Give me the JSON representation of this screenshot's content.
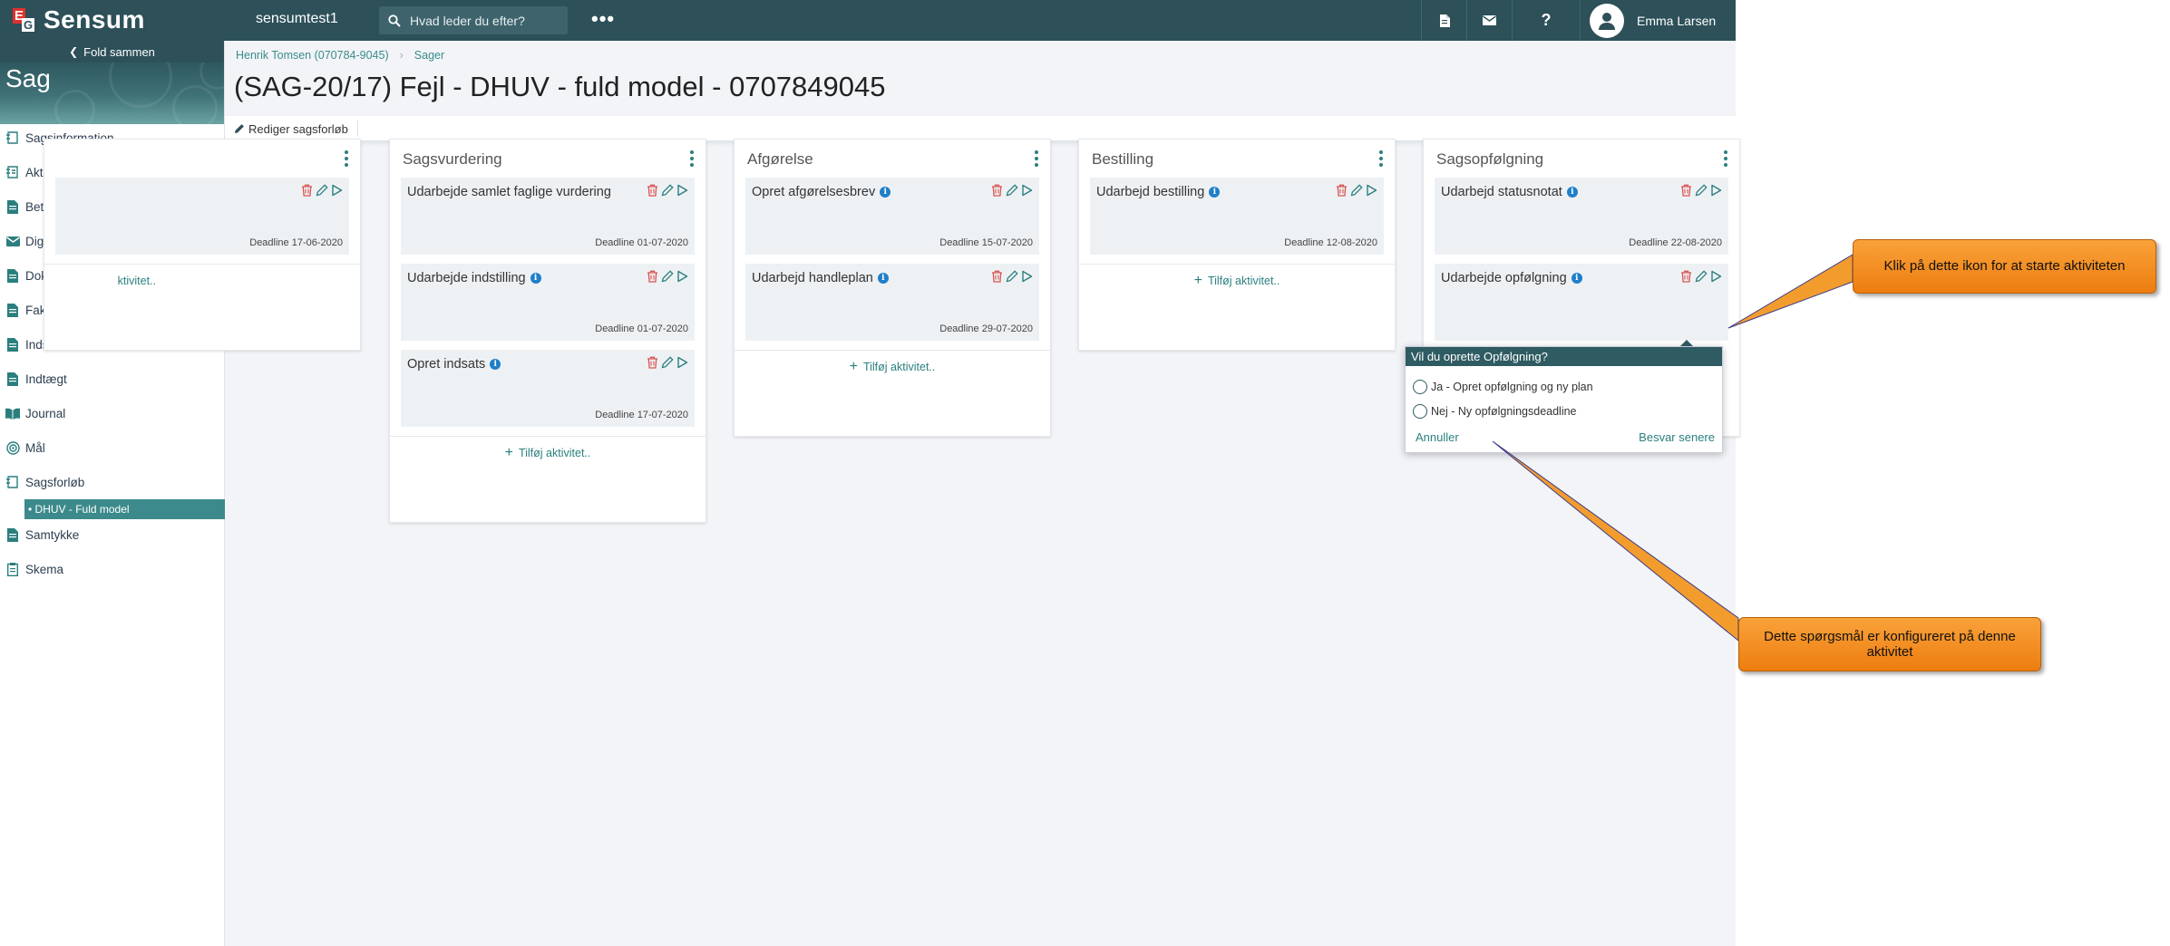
{
  "app": {
    "logo_text": "Sensum",
    "logo_mark": {
      "e": "E",
      "g": "G"
    },
    "tenant": "sensumtest1",
    "search_placeholder": "Hvad leder du efter?",
    "more": "•••",
    "user_name": "Emma Larsen"
  },
  "icons": {
    "topbar": [
      "document-icon",
      "mail-icon",
      "help-icon",
      "user-avatar-icon"
    ],
    "card_actions": [
      "trash-icon",
      "pencil-icon",
      "play-icon"
    ]
  },
  "colors": {
    "topbar": "#2d5059",
    "accent": "#2a7f7e",
    "active_nav": "#3c8a8b",
    "delete": "#d9534f",
    "callout": "#f39c2e",
    "info": "#1f7fc9"
  },
  "sidebar": {
    "fold_label": "Fold sammen",
    "title": "Sag",
    "items": [
      {
        "label": "Sagsinformation",
        "icon": "case-info-icon"
      },
      {
        "label": "Aktiviteter",
        "icon": "activities-icon"
      },
      {
        "label": "Betalingsinformation",
        "icon": "payment-icon"
      },
      {
        "label": "Digital post",
        "icon": "mail-icon"
      },
      {
        "label": "Dokumenter",
        "icon": "documents-icon"
      },
      {
        "label": "Faktura",
        "icon": "invoice-icon"
      },
      {
        "label": "Indsats",
        "icon": "effort-icon"
      },
      {
        "label": "Indtægt",
        "icon": "income-icon"
      },
      {
        "label": "Journal",
        "icon": "journal-icon"
      },
      {
        "label": "Mål",
        "icon": "target-icon"
      },
      {
        "label": "Sagsforløb",
        "icon": "case-flow-icon"
      },
      {
        "label": "Samtykke",
        "icon": "consent-icon"
      },
      {
        "label": "Skema",
        "icon": "form-icon"
      }
    ],
    "active_sub": "• DHUV - Fuld model"
  },
  "main": {
    "breadcrumb": [
      "Henrik Tomsen (070784-9045)",
      "Sager"
    ],
    "title": "(SAG-20/17) Fejl - DHUV - fuld model - 0707849045",
    "edit_label": "Rediger sagsforløb",
    "add_activity": "Tilføj aktivitet..",
    "columns": [
      {
        "title": "",
        "cards": [
          {
            "title": "",
            "info": false,
            "deadline": "Deadline 17-06-2020"
          }
        ],
        "add": "ktivitet.."
      },
      {
        "title": "Sagsvurdering",
        "cards": [
          {
            "title": "Udarbejde samlet faglige vurdering",
            "info": false,
            "deadline": "Deadline 01-07-2020"
          },
          {
            "title": "Udarbejde indstilling",
            "info": true,
            "deadline": "Deadline 01-07-2020"
          },
          {
            "title": "Opret indsats",
            "info": true,
            "deadline": "Deadline 17-07-2020"
          }
        ]
      },
      {
        "title": "Afgørelse",
        "cards": [
          {
            "title": "Opret afgørelsesbrev",
            "info": true,
            "deadline": "Deadline 15-07-2020"
          },
          {
            "title": "Udarbejd handleplan",
            "info": true,
            "deadline": "Deadline 29-07-2020"
          }
        ]
      },
      {
        "title": "Bestilling",
        "cards": [
          {
            "title": "Udarbejd bestilling",
            "info": true,
            "deadline": "Deadline 12-08-2020"
          }
        ]
      },
      {
        "title": "Sagsopfølgning",
        "cards": [
          {
            "title": "Udarbejd statusnotat",
            "info": true,
            "deadline": "Deadline 22-08-2020"
          },
          {
            "title": "Udarbejde opfølgning",
            "info": true,
            "deadline": ""
          }
        ]
      }
    ]
  },
  "popup": {
    "title": "Vil du oprette Opfølgning?",
    "options": [
      "Ja - Opret opfølgning og ny plan",
      "Nej - Ny opfølgningsdeadline"
    ],
    "cancel": "Annuller",
    "later": "Besvar senere"
  },
  "callouts": {
    "top": "Klik på dette ikon for at starte aktiviteten",
    "bottom": "Dette spørgsmål er konfigureret på denne aktivitet"
  }
}
